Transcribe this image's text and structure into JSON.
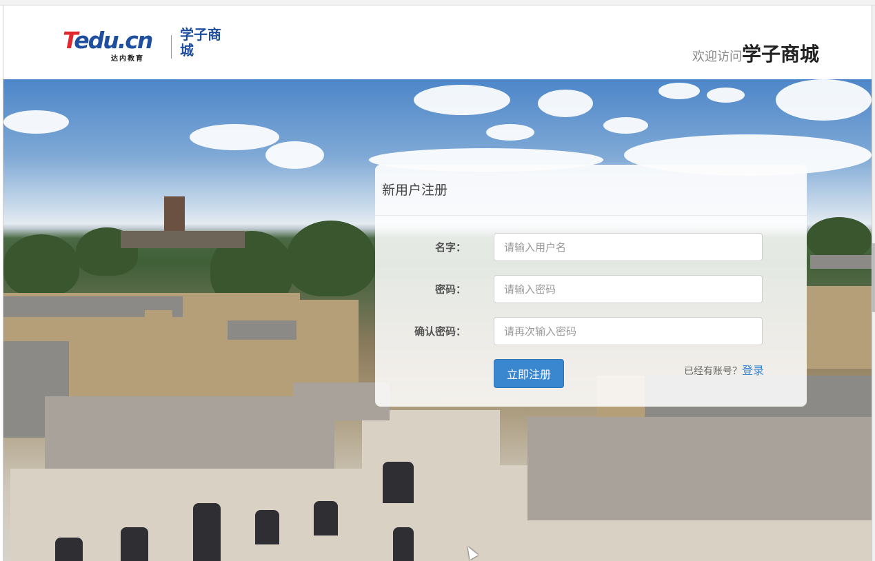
{
  "header": {
    "logo": {
      "brand_text": "Tedu.cn",
      "brand_sub": "达内教育",
      "mall_text": "学子商城"
    },
    "welcome_prefix": "欢迎访问",
    "welcome_name": "学子商城"
  },
  "register_panel": {
    "title": "新用户注册",
    "fields": [
      {
        "label": "名字：",
        "placeholder": "请输入用户名",
        "value": ""
      },
      {
        "label": "密码：",
        "placeholder": "请输入密码",
        "value": ""
      },
      {
        "label": "确认密码：",
        "placeholder": "请再次输入密码",
        "value": ""
      }
    ],
    "submit_label": "立即注册",
    "login_hint": "已经有账号？",
    "login_link": "登录"
  },
  "colors": {
    "brand_blue": "#1e4e9d",
    "brand_red": "#e2282f",
    "primary_button": "#3a87d0",
    "link": "#3a87d0"
  }
}
